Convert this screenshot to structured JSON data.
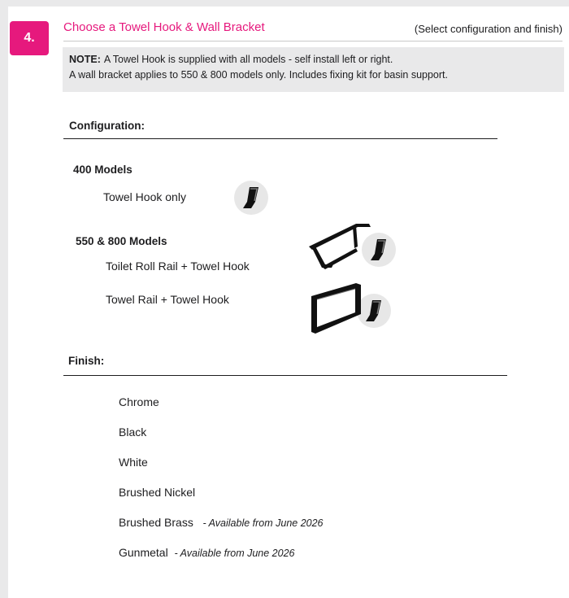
{
  "step": "4.",
  "title": "Choose a Towel Hook & Wall Bracket",
  "hint": "(Select configuration and finish)",
  "note": {
    "label": "NOTE:",
    "line1": "A Towel Hook is supplied with all models - self install left or right.",
    "line2": "A wall bracket applies to 550 & 800 models only.  Includes fixing kit for basin support."
  },
  "configuration": {
    "heading": "Configuration:",
    "groups": [
      {
        "label": "400 Models",
        "options": [
          "Towel Hook only"
        ]
      },
      {
        "label": "550 & 800 Models",
        "options": [
          "Toilet Roll Rail + Towel Hook",
          "Towel Rail + Towel Hook"
        ]
      }
    ]
  },
  "finish": {
    "heading": "Finish:",
    "options": [
      {
        "name": "Chrome",
        "availability": ""
      },
      {
        "name": "Black",
        "availability": ""
      },
      {
        "name": "White",
        "availability": ""
      },
      {
        "name": "Brushed Nickel",
        "availability": ""
      },
      {
        "name": "Brushed Brass",
        "availability": "- Available from June 2026"
      },
      {
        "name": "Gunmetal",
        "availability": "- Available from June 2026"
      }
    ]
  },
  "colors": {
    "accent": "#e6197d",
    "note_bg": "#e9e9ea",
    "icon_circle": "#e7e7e7"
  },
  "icons": [
    "towel-hook-icon",
    "toilet-roll-rail-icon",
    "towel-rail-icon"
  ]
}
